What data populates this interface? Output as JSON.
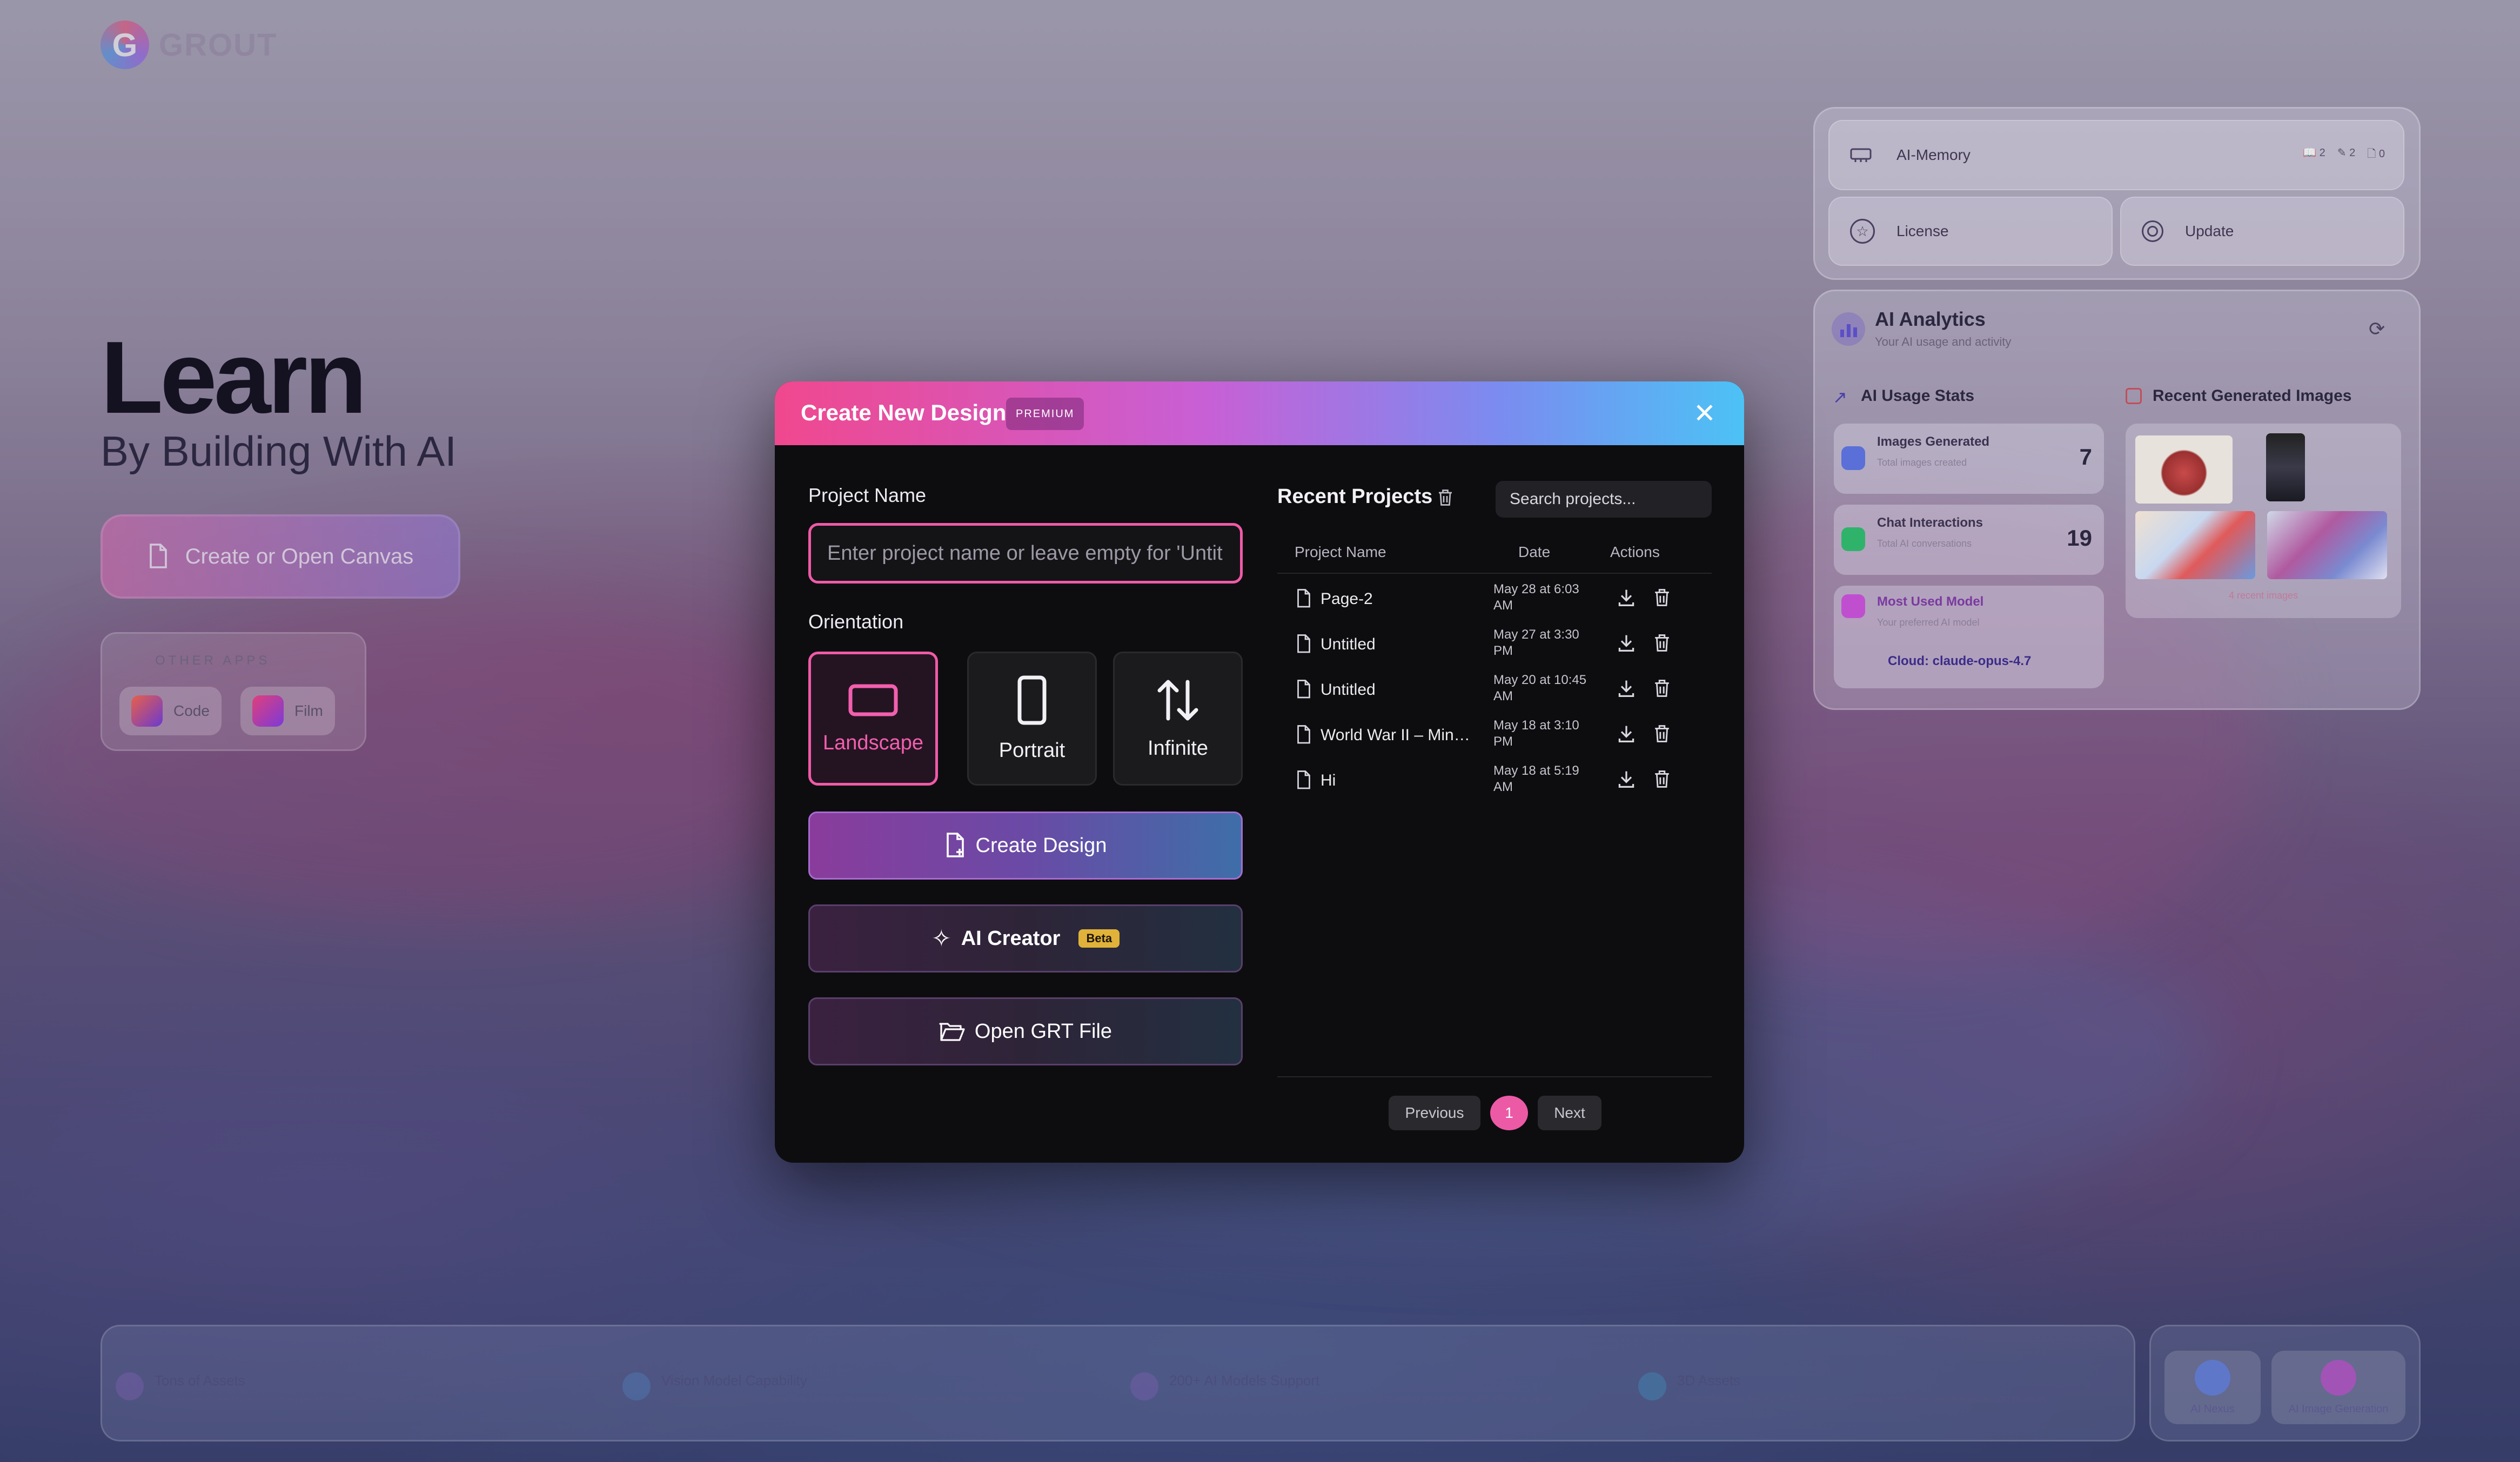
{
  "brand": {
    "logo_letter": "G",
    "name": "GROUT"
  },
  "hero": {
    "title": "Learn",
    "subtitle": "By Building With AI",
    "cta_label": "Create or Open Canvas"
  },
  "other_apps": {
    "label": "OTHER APPS",
    "apps": [
      {
        "label": "Code"
      },
      {
        "label": "Film"
      }
    ]
  },
  "top_panel": {
    "memory_label": "AI-Memory",
    "memory_counts": [
      "2",
      "2",
      "0"
    ],
    "license_label": "License",
    "update_label": "Update"
  },
  "analytics": {
    "title": "AI Analytics",
    "subtitle": "Your AI usage and activity",
    "usage_title": "AI Usage Stats",
    "images_title": "Recent Generated Images",
    "recent_images_caption": "4 recent images",
    "stats": [
      {
        "name": "Images Generated",
        "desc": "Total images created",
        "value": "7",
        "color": "#5a6fd8"
      },
      {
        "name": "Chat Interactions",
        "desc": "Total AI conversations",
        "value": "19",
        "color": "#2fb36a"
      },
      {
        "name": "Most Used Model",
        "desc": "Your preferred AI model",
        "value": "Cloud: claude-opus-4.7",
        "color": "#c04fd0"
      }
    ]
  },
  "features": [
    {
      "title": "Tons of Assets",
      "desc": "Thousands of assets for stunning presentations and creative designs"
    },
    {
      "title": "Vision Model Capability",
      "desc": "Powerful vision model capabilities directly on canvas for enhanced creative workflow"
    },
    {
      "title": "200+ AI Models Support",
      "desc": "Access to over 200 AI models for text, image, and creative generation with offline support"
    },
    {
      "title": "3D Assets",
      "desc": "Comprehensive library of 3D assets for creating immersive presentations and projects"
    }
  ],
  "dock": [
    {
      "label": "AI Nexus"
    },
    {
      "label": "AI Image Generation"
    }
  ],
  "modal": {
    "title": "Create New Design",
    "badge": "PREMIUM",
    "project_name_label": "Project Name",
    "project_name_placeholder": "Enter project name or leave empty for 'Untitled'",
    "orientation_label": "Orientation",
    "orientations": [
      {
        "label": "Landscape",
        "selected": true
      },
      {
        "label": "Portrait",
        "selected": false
      },
      {
        "label": "Infinite",
        "selected": false
      }
    ],
    "create_label": "Create Design",
    "ai_creator_label": "AI Creator",
    "ai_creator_badge": "Beta",
    "open_label": "Open GRT File",
    "recent_title": "Recent Projects",
    "search_placeholder": "Search projects...",
    "columns": [
      "Project Name",
      "Date",
      "Actions"
    ],
    "projects": [
      {
        "name": "Page-2",
        "date": "May 28 at 6:03 AM"
      },
      {
        "name": "Untitled",
        "date": "May 27 at 3:30 PM"
      },
      {
        "name": "Untitled",
        "date": "May 20 at 10:45 AM"
      },
      {
        "name": "World War II – Mind Map",
        "date": "May 18 at 3:10 PM"
      },
      {
        "name": "Hi",
        "date": "May 18 at 5:19 AM"
      }
    ],
    "pagination": {
      "previous": "Previous",
      "current": "1",
      "next": "Next"
    }
  },
  "colors": {
    "accent_pink": "#f05aa7",
    "header_start": "#f0488e",
    "header_end": "#4cc2f5"
  }
}
